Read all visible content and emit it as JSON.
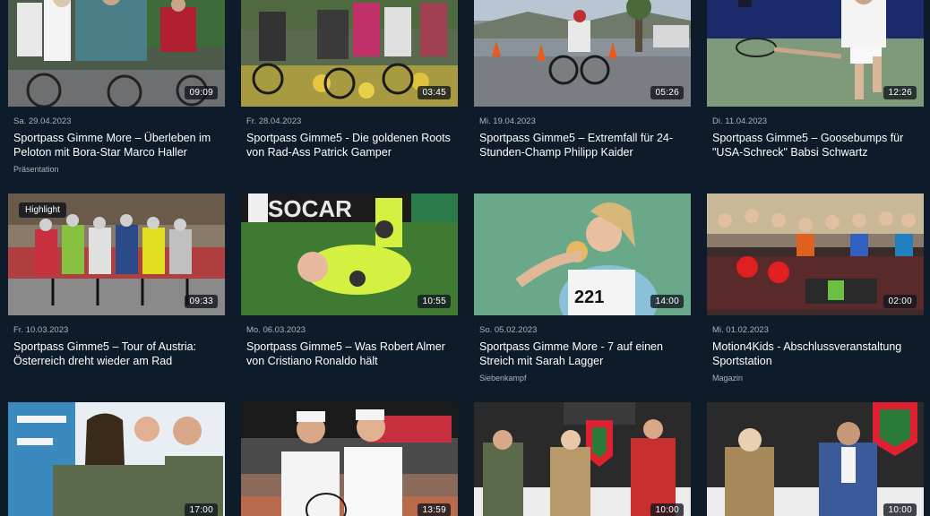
{
  "videos": [
    {
      "date": "Sa. 29.04.2023",
      "title": "Sportpass Gimme More – Überleben im Peloton mit Bora-Star Marco Haller",
      "category": "Präsentation",
      "duration": "09:09",
      "badge": "",
      "thumb_icon": "cycling-peloton-thumbnail"
    },
    {
      "date": "Fr. 28.04.2023",
      "title": "Sportpass Gimme5 - Die goldenen Roots von Rad-Ass Patrick Gamper",
      "category": "",
      "duration": "03:45",
      "badge": "",
      "thumb_icon": "cycling-race-thumbnail"
    },
    {
      "date": "Mi. 19.04.2023",
      "title": "Sportpass Gimme5 – Extremfall für 24-Stunden-Champ Philipp Kaider",
      "category": "",
      "duration": "05:26",
      "badge": "",
      "thumb_icon": "cyclist-road-thumbnail"
    },
    {
      "date": "Di. 11.04.2023",
      "title": "Sportpass Gimme5 – Goosebumps für \"USA-Schreck\" Babsi Schwartz",
      "category": "",
      "duration": "12:26",
      "badge": "",
      "thumb_icon": "tennis-player-thumbnail"
    },
    {
      "date": "Fr. 10.03.2023",
      "title": "Sportpass Gimme5 – Tour of Austria: Österreich dreht wieder am Rad",
      "category": "",
      "duration": "09:33",
      "badge": "Highlight",
      "thumb_icon": "cycling-tour-thumbnail"
    },
    {
      "date": "Mo. 06.03.2023",
      "title": "Sportpass Gimme5 – Was Robert Almer von Cristiano Ronaldo hält",
      "category": "",
      "duration": "10:55",
      "badge": "",
      "thumb_icon": "goalkeeper-thumbnail"
    },
    {
      "date": "So. 05.02.2023",
      "title": "Sportpass Gimme More - 7 auf einen Streich mit Sarah Lagger",
      "category": "Siebenkampf",
      "duration": "14:00",
      "badge": "",
      "thumb_icon": "shot-put-athlete-thumbnail"
    },
    {
      "date": "Mi. 01.02.2023",
      "title": "Motion4Kids - Abschlussveranstaltung Sportstation",
      "category": "Magazin",
      "duration": "02:00",
      "badge": "",
      "thumb_icon": "kids-crowd-thumbnail"
    },
    {
      "date": "",
      "title": "",
      "category": "",
      "duration": "17:00",
      "badge": "",
      "thumb_icon": "athletes-group-thumbnail"
    },
    {
      "date": "",
      "title": "",
      "category": "",
      "duration": "13:59",
      "badge": "",
      "thumb_icon": "tennis-duo-thumbnail"
    },
    {
      "date": "",
      "title": "",
      "category": "",
      "duration": "10:00",
      "badge": "",
      "thumb_icon": "interview-panel-thumbnail"
    },
    {
      "date": "",
      "title": "",
      "category": "",
      "duration": "10:00",
      "badge": "",
      "thumb_icon": "interview-duo-thumbnail"
    }
  ],
  "colors": {
    "background": "#0d1b2a",
    "text": "#ffffff",
    "muted": "#a8b4c2"
  }
}
